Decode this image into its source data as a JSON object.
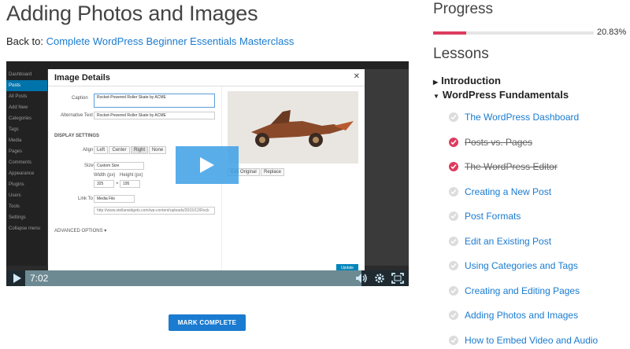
{
  "page": {
    "title": "Adding Photos and Images",
    "back_prefix": "Back to: ",
    "back_link": "Complete WordPress Beginner Essentials Masterclass"
  },
  "video": {
    "time": "7:02",
    "modal": {
      "title": "Image Details",
      "caption_label": "Caption",
      "caption_value": "Rocket-Powered Roller Skate by ACME",
      "alt_label": "Alternative Text",
      "alt_value": "Rocket-Powered Roller Skate by ACME",
      "display_settings": "DISPLAY SETTINGS",
      "align_label": "Align",
      "align_options": [
        "Left",
        "Center",
        "Right",
        "None"
      ],
      "size_label": "Size",
      "size_value": "Custom Size",
      "width_label": "Width (px)",
      "width_value": "325",
      "height_label": "Height (px)",
      "height_value": "195",
      "link_label": "Link To",
      "link_value": "Media File",
      "link_url": "http://www.stellarwidgets.com/wp-content/uploads/2015/12/Rock",
      "advanced": "ADVANCED OPTIONS ▾",
      "edit_original": "Edit Original",
      "replace": "Replace",
      "update": "Update"
    },
    "sidebar": [
      "Dashboard",
      "Posts",
      "All Posts",
      "Add New",
      "Categories",
      "Tags",
      "Media",
      "Pages",
      "Comments",
      "Appearance",
      "Plugins",
      "Users",
      "Tools",
      "Settings",
      "Collapse menu"
    ]
  },
  "mark_complete": "MARK COMPLETE",
  "progress": {
    "title": "Progress",
    "percent_label": "20.83%",
    "fraction": 0.2083
  },
  "lessons": {
    "title": "Lessons",
    "sections": [
      {
        "label": "Introduction",
        "expanded": false
      },
      {
        "label": "WordPress Fundamentals",
        "expanded": true
      }
    ],
    "items": [
      {
        "label": "The WordPress Dashboard",
        "done": false
      },
      {
        "label": "Posts vs. Pages",
        "done": true
      },
      {
        "label": "The WordPress Editor",
        "done": true
      },
      {
        "label": "Creating a New Post",
        "done": false
      },
      {
        "label": "Post Formats",
        "done": false
      },
      {
        "label": "Edit an Existing Post",
        "done": false
      },
      {
        "label": "Using Categories and Tags",
        "done": false
      },
      {
        "label": "Creating and Editing Pages",
        "done": false
      },
      {
        "label": "Adding Photos and Images",
        "done": false
      },
      {
        "label": "How to Embed Video and Audio",
        "done": false
      }
    ]
  },
  "colors": {
    "accent": "#1a7bd0",
    "progress": "#dc3c5f",
    "todo": "#dcdcdc"
  }
}
